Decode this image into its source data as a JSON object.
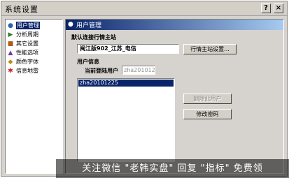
{
  "window": {
    "title": "系统设置",
    "help_glyph": "?",
    "close_glyph": "×"
  },
  "sidebar": {
    "items": [
      {
        "label": "用户管理",
        "icon": "users-icon",
        "active": true
      },
      {
        "label": "分析周期",
        "icon": "cycle-icon"
      },
      {
        "label": "其它设置",
        "icon": "settings-icon"
      },
      {
        "label": "性能选项",
        "icon": "performance-icon"
      },
      {
        "label": "颜色字体",
        "icon": "palette-icon"
      },
      {
        "label": "信息地雷",
        "icon": "mine-icon"
      }
    ]
  },
  "panel": {
    "title": "用户管理",
    "default_server_label": "默认连接行情主站",
    "default_server_value": "闽江版902_江苏_电信",
    "server_settings_button": "行情主站设置...",
    "user_info_label": "用户信息",
    "current_user_label": "当前登陆用户",
    "current_user_value": "zha20101225",
    "users": [
      "zha20101225"
    ],
    "delete_user_button": "删除此用户",
    "change_password_button": "修改密码"
  },
  "watermark": {
    "text": "关注微信 \"老韩实盘\" 回复 \"指标\" 免费领"
  },
  "colors": {
    "selection": "#0a246a",
    "window_bg": "#d6d3ce"
  }
}
